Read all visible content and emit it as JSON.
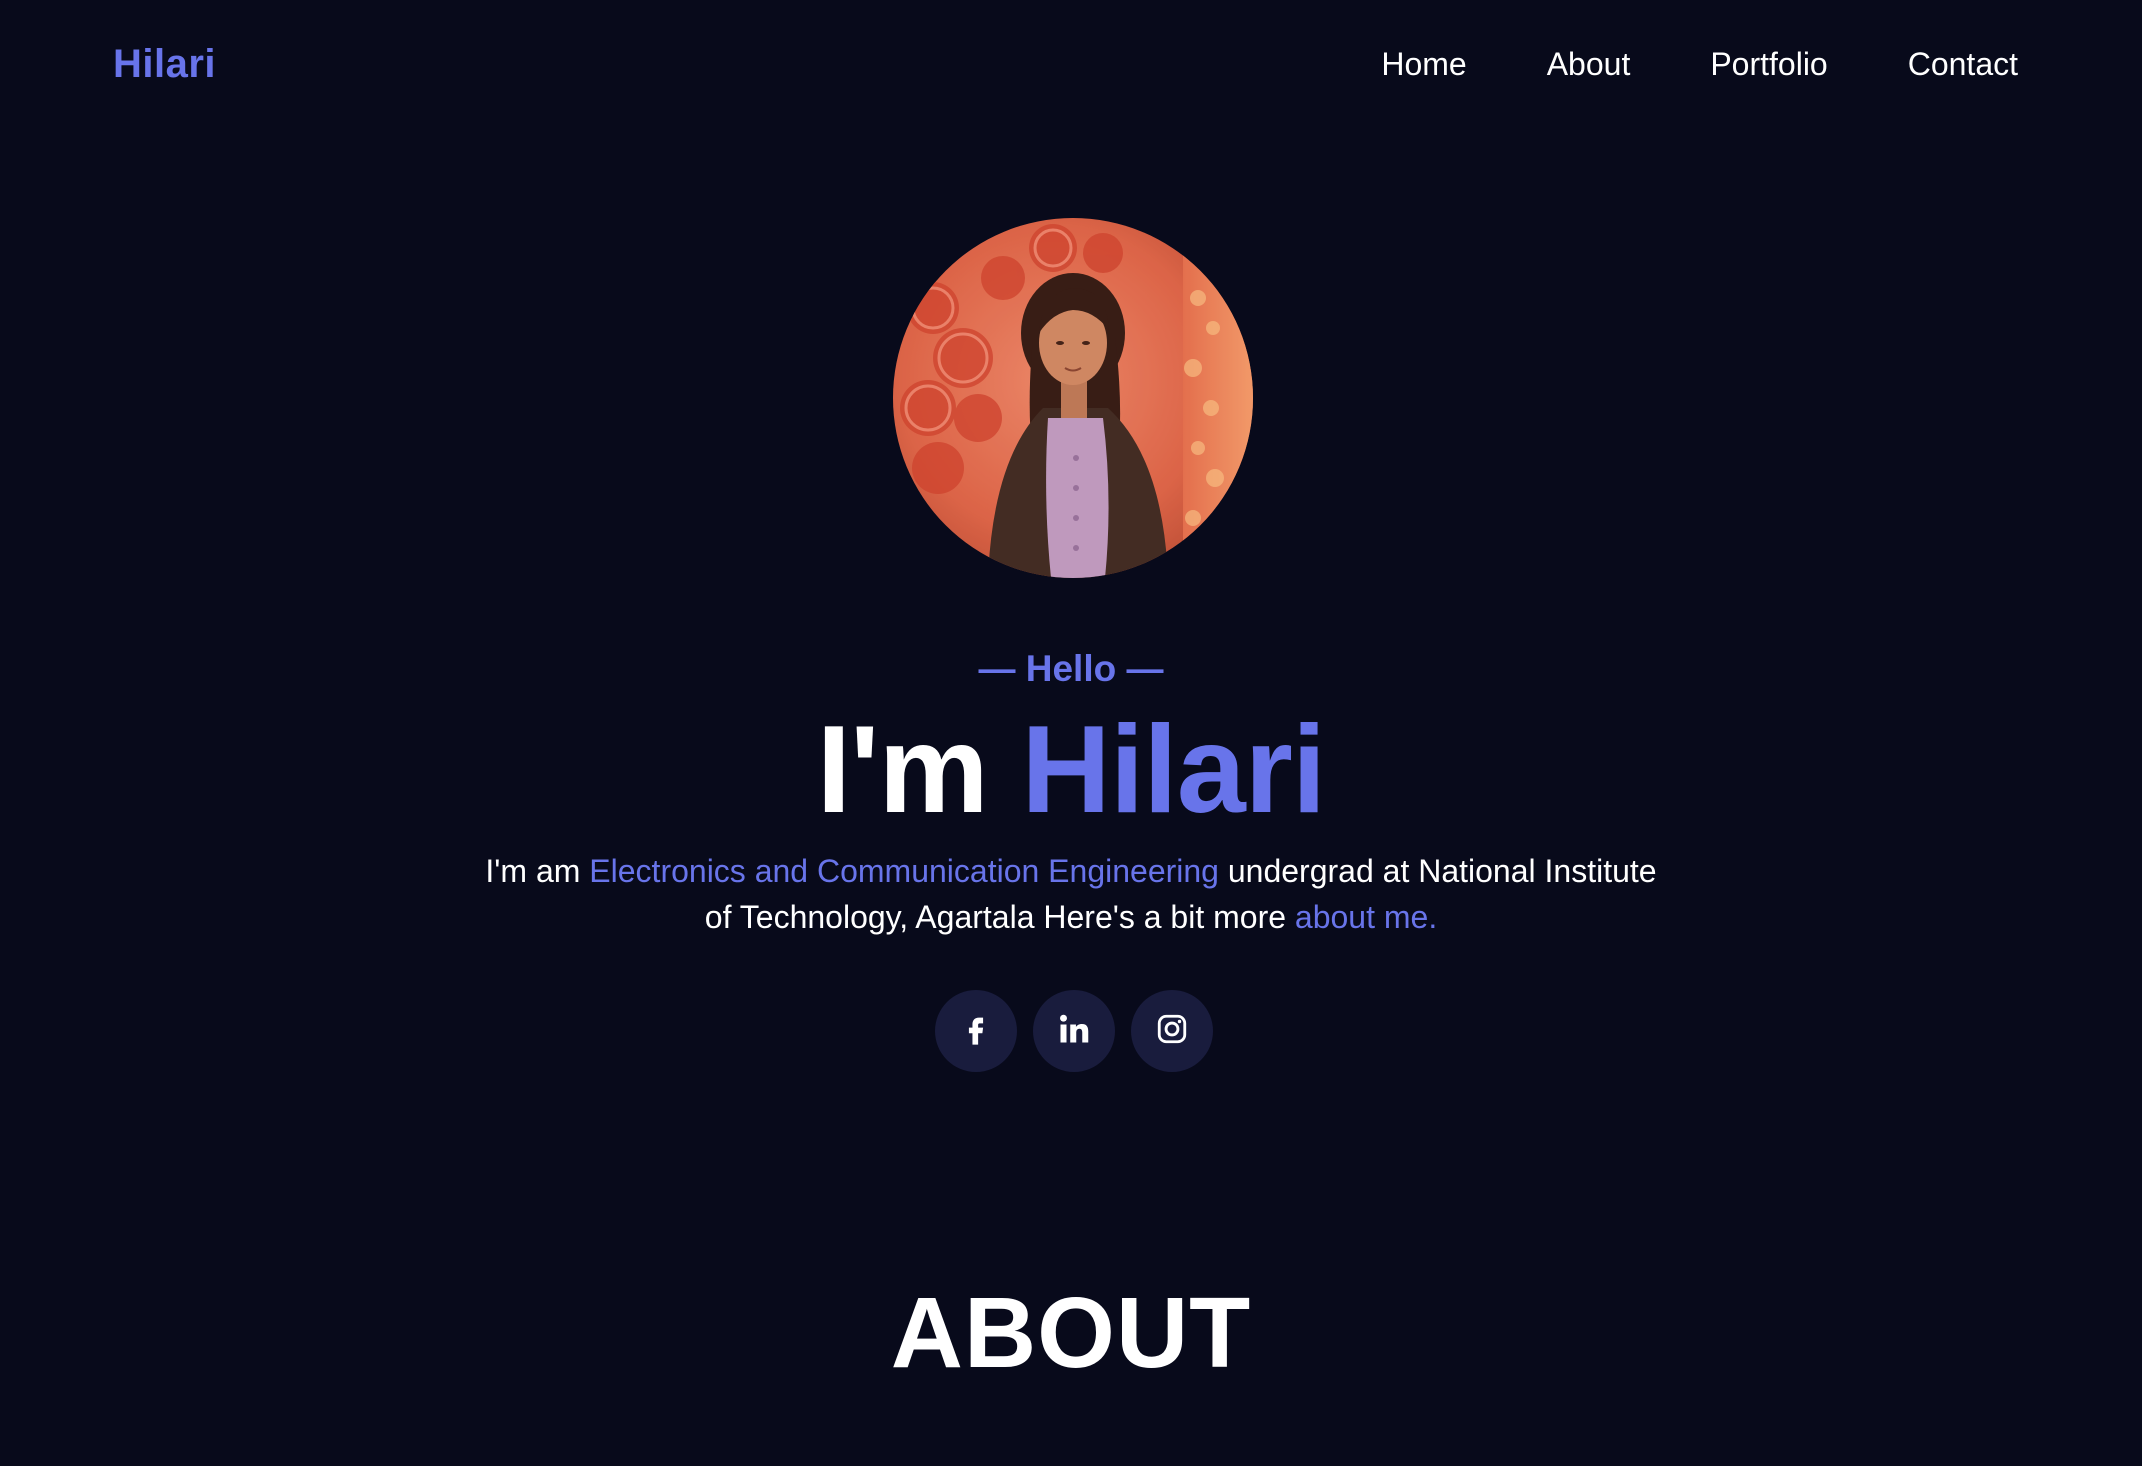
{
  "nav": {
    "brand": "Hilari",
    "links": [
      "Home",
      "About",
      "Portfolio",
      "Contact"
    ]
  },
  "hero": {
    "avatar_alt": "Profile photo of Hilari",
    "hello": "— Hello —",
    "title_prefix": "I'm ",
    "title_name": "Hilari",
    "intro_1": "I'm am ",
    "intro_highlight": "Electronics and Communication Engineering",
    "intro_2": " undergrad at National Institute of Technology, Agartala Here's a bit more ",
    "intro_link": "about me."
  },
  "socials": [
    {
      "icon": "facebook-icon"
    },
    {
      "icon": "linkedin-icon"
    },
    {
      "icon": "instagram-icon"
    }
  ],
  "sections": {
    "about_title": "ABOUT"
  },
  "colors": {
    "background": "#080a1b",
    "accent": "#6874ea",
    "social_bg": "#191c3d",
    "text": "#ffffff"
  }
}
